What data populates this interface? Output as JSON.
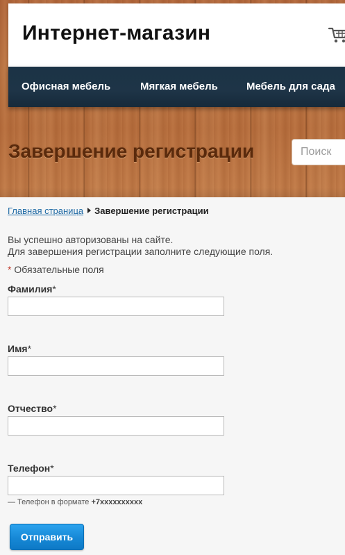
{
  "header": {
    "brand_title": "Интернет-магазин",
    "cart_icon": "shopping-cart-icon",
    "nav": [
      {
        "label": "Офисная мебель"
      },
      {
        "label": "Мягкая мебель"
      },
      {
        "label": "Мебель для сада"
      }
    ],
    "page_title": "Завершение регистрации",
    "search_placeholder": "Поиск"
  },
  "breadcrumb": {
    "home": "Главная страница",
    "current": "Завершение регистрации"
  },
  "messages": {
    "line1": "Вы успешно авторизованы на сайте.",
    "line2": "Для завершения регистрации заполните следующие поля."
  },
  "required_note": {
    "star": "*",
    "text": "Обязательные поля"
  },
  "form": {
    "fields": [
      {
        "label": "Фамилия",
        "required_mark": "*",
        "value": ""
      },
      {
        "label": "Имя",
        "required_mark": "*",
        "value": ""
      },
      {
        "label": "Отчество",
        "required_mark": "*",
        "value": ""
      },
      {
        "label": "Телефон",
        "required_mark": "*",
        "value": ""
      }
    ],
    "phone_hint_prefix": "— Телефон в формате",
    "phone_hint_format": "+7xxxxxxxxxx",
    "submit_label": "Отправить"
  },
  "colors": {
    "nav_bg": "#1e3447",
    "title_brown": "#5a2a0c",
    "button_blue": "#1688d6",
    "link_blue": "#1f6aa5",
    "required_red": "#c0392b"
  }
}
